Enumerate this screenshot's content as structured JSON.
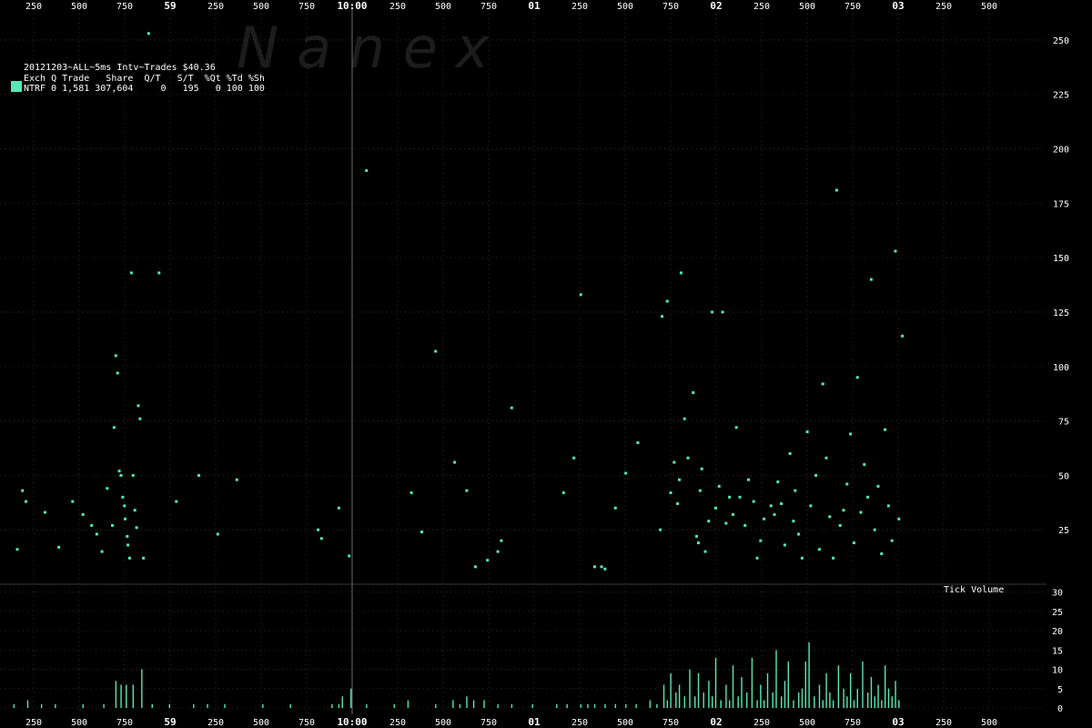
{
  "chart_data": {
    "type": "scatter",
    "header": {
      "title": "20121203~ALL~5ms Intv~Trades $40.36",
      "columns": "Exch Q Trade   Share  Q/T   S/T  %Qt %Td %Sh",
      "row": "NTRF 0 1,581 307,604     0   195   0 100 100",
      "series_color": "#55e8b8"
    },
    "watermark": "N   a   n   e   x",
    "x_axis": {
      "tick_labels": [
        "250",
        "500",
        "750",
        "59",
        "250",
        "500",
        "750",
        "10:00",
        "250",
        "500",
        "750",
        "01",
        "250",
        "500",
        "750",
        "02",
        "250",
        "500",
        "750",
        "03",
        "250",
        "500"
      ],
      "major_labels": [
        "59",
        "10:00",
        "01",
        "02",
        "03"
      ],
      "range_ms_from_09_58_00": [
        0,
        302700
      ]
    },
    "upper_panel": {
      "type": "scatter",
      "ylim": [
        0,
        260
      ],
      "y_ticks": [
        "250",
        "225",
        "200",
        "175",
        "150",
        "125",
        "100",
        "75",
        "50",
        "25"
      ],
      "y_tick_values": [
        250,
        225,
        200,
        175,
        150,
        125,
        100,
        75,
        50,
        25
      ],
      "points": [
        [
          5000,
          16
        ],
        [
          6500,
          43
        ],
        [
          7500,
          38
        ],
        [
          13000,
          33
        ],
        [
          17000,
          17
        ],
        [
          21000,
          38
        ],
        [
          24000,
          32
        ],
        [
          26500,
          27
        ],
        [
          28000,
          23
        ],
        [
          29500,
          15
        ],
        [
          31000,
          44
        ],
        [
          32500,
          27
        ],
        [
          33000,
          72
        ],
        [
          33500,
          105
        ],
        [
          34000,
          97
        ],
        [
          34500,
          52
        ],
        [
          35000,
          50
        ],
        [
          35500,
          40
        ],
        [
          36000,
          36
        ],
        [
          36200,
          30
        ],
        [
          36800,
          22
        ],
        [
          37000,
          18
        ],
        [
          37500,
          12
        ],
        [
          38000,
          143
        ],
        [
          38500,
          50
        ],
        [
          39000,
          34
        ],
        [
          39500,
          26
        ],
        [
          40000,
          82
        ],
        [
          40500,
          76
        ],
        [
          41500,
          12
        ],
        [
          43000,
          253
        ],
        [
          46000,
          143
        ],
        [
          51000,
          38
        ],
        [
          57500,
          50
        ],
        [
          63000,
          23
        ],
        [
          68500,
          48
        ],
        [
          92000,
          25
        ],
        [
          93000,
          21
        ],
        [
          98000,
          35
        ],
        [
          101000,
          13
        ],
        [
          106000,
          190
        ],
        [
          119000,
          42
        ],
        [
          122000,
          24
        ],
        [
          126000,
          107
        ],
        [
          131500,
          56
        ],
        [
          135000,
          43
        ],
        [
          137500,
          8
        ],
        [
          141000,
          11
        ],
        [
          144000,
          15
        ],
        [
          145000,
          20
        ],
        [
          148000,
          81
        ],
        [
          163000,
          42
        ],
        [
          166000,
          58
        ],
        [
          168000,
          133
        ],
        [
          172000,
          8
        ],
        [
          174000,
          8
        ],
        [
          175000,
          7
        ],
        [
          178000,
          35
        ],
        [
          181000,
          51
        ],
        [
          184500,
          65
        ],
        [
          191000,
          25
        ],
        [
          191500,
          123
        ],
        [
          193000,
          130
        ],
        [
          194000,
          42
        ],
        [
          195000,
          56
        ],
        [
          196000,
          37
        ],
        [
          196500,
          48
        ],
        [
          197000,
          143
        ],
        [
          198000,
          76
        ],
        [
          199000,
          58
        ],
        [
          200500,
          88
        ],
        [
          201500,
          22
        ],
        [
          202000,
          19
        ],
        [
          202500,
          43
        ],
        [
          203000,
          53
        ],
        [
          204000,
          15
        ],
        [
          205000,
          29
        ],
        [
          206000,
          125
        ],
        [
          207000,
          35
        ],
        [
          208000,
          45
        ],
        [
          209000,
          125
        ],
        [
          210000,
          28
        ],
        [
          211000,
          40
        ],
        [
          212000,
          32
        ],
        [
          213000,
          72
        ],
        [
          214000,
          40
        ],
        [
          215500,
          27
        ],
        [
          216500,
          48
        ],
        [
          218000,
          38
        ],
        [
          219000,
          12
        ],
        [
          220000,
          20
        ],
        [
          221000,
          30
        ],
        [
          223000,
          36
        ],
        [
          224000,
          32
        ],
        [
          225000,
          47
        ],
        [
          226000,
          37
        ],
        [
          227000,
          18
        ],
        [
          228500,
          60
        ],
        [
          229500,
          29
        ],
        [
          230000,
          43
        ],
        [
          231000,
          23
        ],
        [
          232000,
          12
        ],
        [
          233500,
          70
        ],
        [
          234500,
          36
        ],
        [
          236000,
          50
        ],
        [
          237000,
          16
        ],
        [
          238000,
          92
        ],
        [
          239000,
          58
        ],
        [
          240000,
          31
        ],
        [
          241000,
          12
        ],
        [
          242000,
          181
        ],
        [
          243000,
          27
        ],
        [
          244000,
          34
        ],
        [
          245000,
          46
        ],
        [
          246000,
          69
        ],
        [
          247000,
          19
        ],
        [
          248000,
          95
        ],
        [
          249000,
          33
        ],
        [
          250000,
          55
        ],
        [
          251000,
          40
        ],
        [
          252000,
          140
        ],
        [
          253000,
          25
        ],
        [
          254000,
          45
        ],
        [
          255000,
          14
        ],
        [
          256000,
          71
        ],
        [
          257000,
          36
        ],
        [
          258000,
          20
        ],
        [
          259000,
          153
        ],
        [
          260000,
          30
        ],
        [
          261000,
          114
        ]
      ]
    },
    "lower_panel": {
      "type": "bar",
      "label": "Tick Volume",
      "ylim": [
        0,
        32
      ],
      "y_ticks": [
        "30",
        "25",
        "20",
        "15",
        "10",
        "5",
        "0"
      ],
      "y_tick_values": [
        30,
        25,
        20,
        15,
        10,
        5,
        0
      ],
      "bars": [
        [
          4000,
          1
        ],
        [
          8000,
          2
        ],
        [
          12000,
          1
        ],
        [
          16000,
          1
        ],
        [
          24000,
          1
        ],
        [
          30000,
          1
        ],
        [
          33500,
          7
        ],
        [
          35000,
          6
        ],
        [
          36500,
          6
        ],
        [
          38500,
          6
        ],
        [
          41000,
          10
        ],
        [
          44000,
          1
        ],
        [
          49000,
          1
        ],
        [
          56000,
          1
        ],
        [
          60000,
          1
        ],
        [
          65000,
          1
        ],
        [
          76000,
          1
        ],
        [
          84000,
          1
        ],
        [
          96000,
          1
        ],
        [
          98000,
          1
        ],
        [
          99000,
          3
        ],
        [
          101500,
          5
        ],
        [
          106000,
          1
        ],
        [
          114000,
          1
        ],
        [
          118000,
          2
        ],
        [
          126000,
          1
        ],
        [
          131000,
          2
        ],
        [
          133000,
          1
        ],
        [
          135000,
          3
        ],
        [
          137000,
          2
        ],
        [
          140000,
          2
        ],
        [
          144000,
          1
        ],
        [
          148000,
          1
        ],
        [
          154000,
          1
        ],
        [
          161000,
          1
        ],
        [
          164000,
          1
        ],
        [
          168000,
          1
        ],
        [
          170000,
          1
        ],
        [
          172000,
          1
        ],
        [
          175000,
          1
        ],
        [
          178000,
          1
        ],
        [
          181000,
          1
        ],
        [
          184000,
          1
        ],
        [
          188000,
          2
        ],
        [
          190000,
          1
        ],
        [
          192000,
          6
        ],
        [
          193000,
          2
        ],
        [
          194000,
          9
        ],
        [
          195500,
          4
        ],
        [
          196500,
          6
        ],
        [
          198000,
          3
        ],
        [
          199500,
          10
        ],
        [
          201000,
          3
        ],
        [
          202000,
          9
        ],
        [
          203500,
          4
        ],
        [
          205000,
          7
        ],
        [
          206000,
          3
        ],
        [
          207000,
          13
        ],
        [
          208500,
          2
        ],
        [
          210000,
          6
        ],
        [
          211000,
          2
        ],
        [
          212000,
          11
        ],
        [
          213500,
          3
        ],
        [
          214500,
          8
        ],
        [
          216000,
          4
        ],
        [
          217500,
          13
        ],
        [
          219000,
          2
        ],
        [
          220000,
          6
        ],
        [
          221000,
          2
        ],
        [
          222000,
          9
        ],
        [
          223500,
          4
        ],
        [
          224500,
          15
        ],
        [
          226000,
          3
        ],
        [
          227000,
          7
        ],
        [
          228000,
          12
        ],
        [
          229500,
          2
        ],
        [
          231000,
          4
        ],
        [
          232000,
          5
        ],
        [
          233000,
          12
        ],
        [
          234000,
          17
        ],
        [
          235500,
          3
        ],
        [
          237000,
          6
        ],
        [
          238000,
          2
        ],
        [
          239000,
          9
        ],
        [
          240000,
          4
        ],
        [
          241000,
          2
        ],
        [
          242500,
          11
        ],
        [
          244000,
          5
        ],
        [
          245000,
          3
        ],
        [
          246000,
          9
        ],
        [
          247000,
          2
        ],
        [
          248000,
          5
        ],
        [
          249500,
          12
        ],
        [
          251000,
          4
        ],
        [
          252000,
          8
        ],
        [
          253000,
          3
        ],
        [
          254000,
          6
        ],
        [
          255000,
          2
        ],
        [
          256000,
          11
        ],
        [
          257000,
          5
        ],
        [
          258000,
          3
        ],
        [
          259000,
          7
        ],
        [
          260000,
          2
        ]
      ]
    }
  }
}
